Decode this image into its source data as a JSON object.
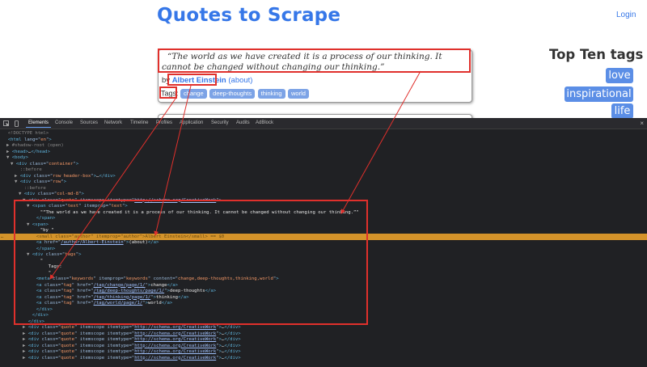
{
  "site": {
    "title": "Quotes to Scrape",
    "login": "Login",
    "quote": {
      "text": "“The world as we have created it is a process of our thinking. It cannot be changed without changing our thinking.”",
      "by": "by",
      "author": "Albert Einstein",
      "about": "(about)",
      "tags_label": "Tags:",
      "tags": [
        "change",
        "deep-thoughts",
        "thinking",
        "world"
      ]
    },
    "top_tags": {
      "title": "Top Ten tags",
      "items": [
        "love",
        "inspirational",
        "life"
      ]
    }
  },
  "devtools": {
    "tabs": [
      "Elements",
      "Console",
      "Sources",
      "Network",
      "Timeline",
      "Profiles",
      "Application",
      "Security",
      "Audits",
      "AdBlock"
    ],
    "active_tab": "Elements",
    "close": "×",
    "lines": [
      {
        "i": 0,
        "tri": "",
        "t": "<!DOCTYPE html>"
      },
      {
        "i": 0,
        "tri": "",
        "t": "<html lang=\"en\">"
      },
      {
        "i": 1,
        "tri": "▶",
        "t": "#shadow-root (open)"
      },
      {
        "i": 1,
        "tri": "▶",
        "t": "<head>…</head>"
      },
      {
        "i": 1,
        "tri": "▼",
        "t": "<body>"
      },
      {
        "i": 2,
        "tri": "▼",
        "t": "<div class=\"container\">"
      },
      {
        "i": 3,
        "tri": "",
        "t": "::before"
      },
      {
        "i": 3,
        "tri": "▶",
        "t": "<div class=\"row header-box\">…</div>"
      },
      {
        "i": 3,
        "tri": "▼",
        "t": "<div class=\"row\">"
      },
      {
        "i": 4,
        "tri": "",
        "t": "::before"
      },
      {
        "i": 4,
        "tri": "▼",
        "t": "<div class=\"col-md-8\">"
      },
      {
        "i": 5,
        "tri": "▼",
        "t": "<div class=\"quote\" itemscope itemtype=\"http://schema.org/CreativeWork\">"
      },
      {
        "i": 6,
        "tri": "▼",
        "t": "<span class=\"text\" itemprop=\"text\">"
      },
      {
        "i": 8,
        "tri": "",
        "t": "\"“The world as we have created it is a process of our thinking. It cannot be changed without changing our thinking.”\""
      },
      {
        "i": 7,
        "tri": "",
        "t": "</span>"
      },
      {
        "i": 6,
        "tri": "▼",
        "t": "<span>"
      },
      {
        "i": 8,
        "tri": "",
        "t": "\"by \""
      },
      {
        "i": 7,
        "tri": "",
        "t": "<small class=\"author\" itemprop=\"author\">Albert Einstein</small> == $0"
      },
      {
        "i": 7,
        "tri": "",
        "t": "<a href=\"/author/Albert-Einstein\">(about)</a>"
      },
      {
        "i": 7,
        "tri": "",
        "t": "</span>"
      },
      {
        "i": 6,
        "tri": "▼",
        "t": "<div class=\"tags\">"
      },
      {
        "i": 8,
        "tri": "",
        "t": "\""
      },
      {
        "i": 10,
        "tri": "",
        "t": "Tags:"
      },
      {
        "i": 10,
        "tri": "",
        "t": "\""
      },
      {
        "i": 7,
        "tri": "",
        "t": "<meta class=\"keywords\" itemprop=\"keywords\" content=\"change,deep-thoughts,thinking,world\">"
      },
      {
        "i": 7,
        "tri": "",
        "t": "<a class=\"tag\" href=\"/tag/change/page/1/\">change</a>"
      },
      {
        "i": 7,
        "tri": "",
        "t": "<a class=\"tag\" href=\"/tag/deep-thoughts/page/1/\">deep-thoughts</a>"
      },
      {
        "i": 7,
        "tri": "",
        "t": "<a class=\"tag\" href=\"/tag/thinking/page/1/\">thinking</a>"
      },
      {
        "i": 7,
        "tri": "",
        "t": "<a class=\"tag\" href=\"/tag/world/page/1/\">world</a>"
      },
      {
        "i": 7,
        "tri": "",
        "t": "</div>"
      },
      {
        "i": 6,
        "tri": "",
        "t": "</div>"
      },
      {
        "i": 5,
        "tri": "",
        "t": "</div>"
      },
      {
        "i": 5,
        "tri": "▶",
        "t": "<div class=\"quote\" itemscope itemtype=\"http://schema.org/CreativeWork\">…</div>"
      },
      {
        "i": 5,
        "tri": "▶",
        "t": "<div class=\"quote\" itemscope itemtype=\"http://schema.org/CreativeWork\">…</div>"
      },
      {
        "i": 5,
        "tri": "▶",
        "t": "<div class=\"quote\" itemscope itemtype=\"http://schema.org/CreativeWork\">…</div>"
      },
      {
        "i": 5,
        "tri": "▶",
        "t": "<div class=\"quote\" itemscope itemtype=\"http://schema.org/CreativeWork\">…</div>"
      },
      {
        "i": 5,
        "tri": "▶",
        "t": "<div class=\"quote\" itemscope itemtype=\"http://schema.org/CreativeWork\">…</div>"
      },
      {
        "i": 5,
        "tri": "▶",
        "t": "<div class=\"quote\" itemscope itemtype=\"http://schema.org/CreativeWork\">…</div>"
      }
    ],
    "highlighted_line": 17
  },
  "colors": {
    "brand_blue": "#3677e8",
    "tag_bg": "#7ca3e6",
    "top_tag_bg": "#5b8ee6",
    "annotation_red": "#e0302c",
    "devtools_bg": "#202124",
    "selected_line": "#d4932a"
  }
}
